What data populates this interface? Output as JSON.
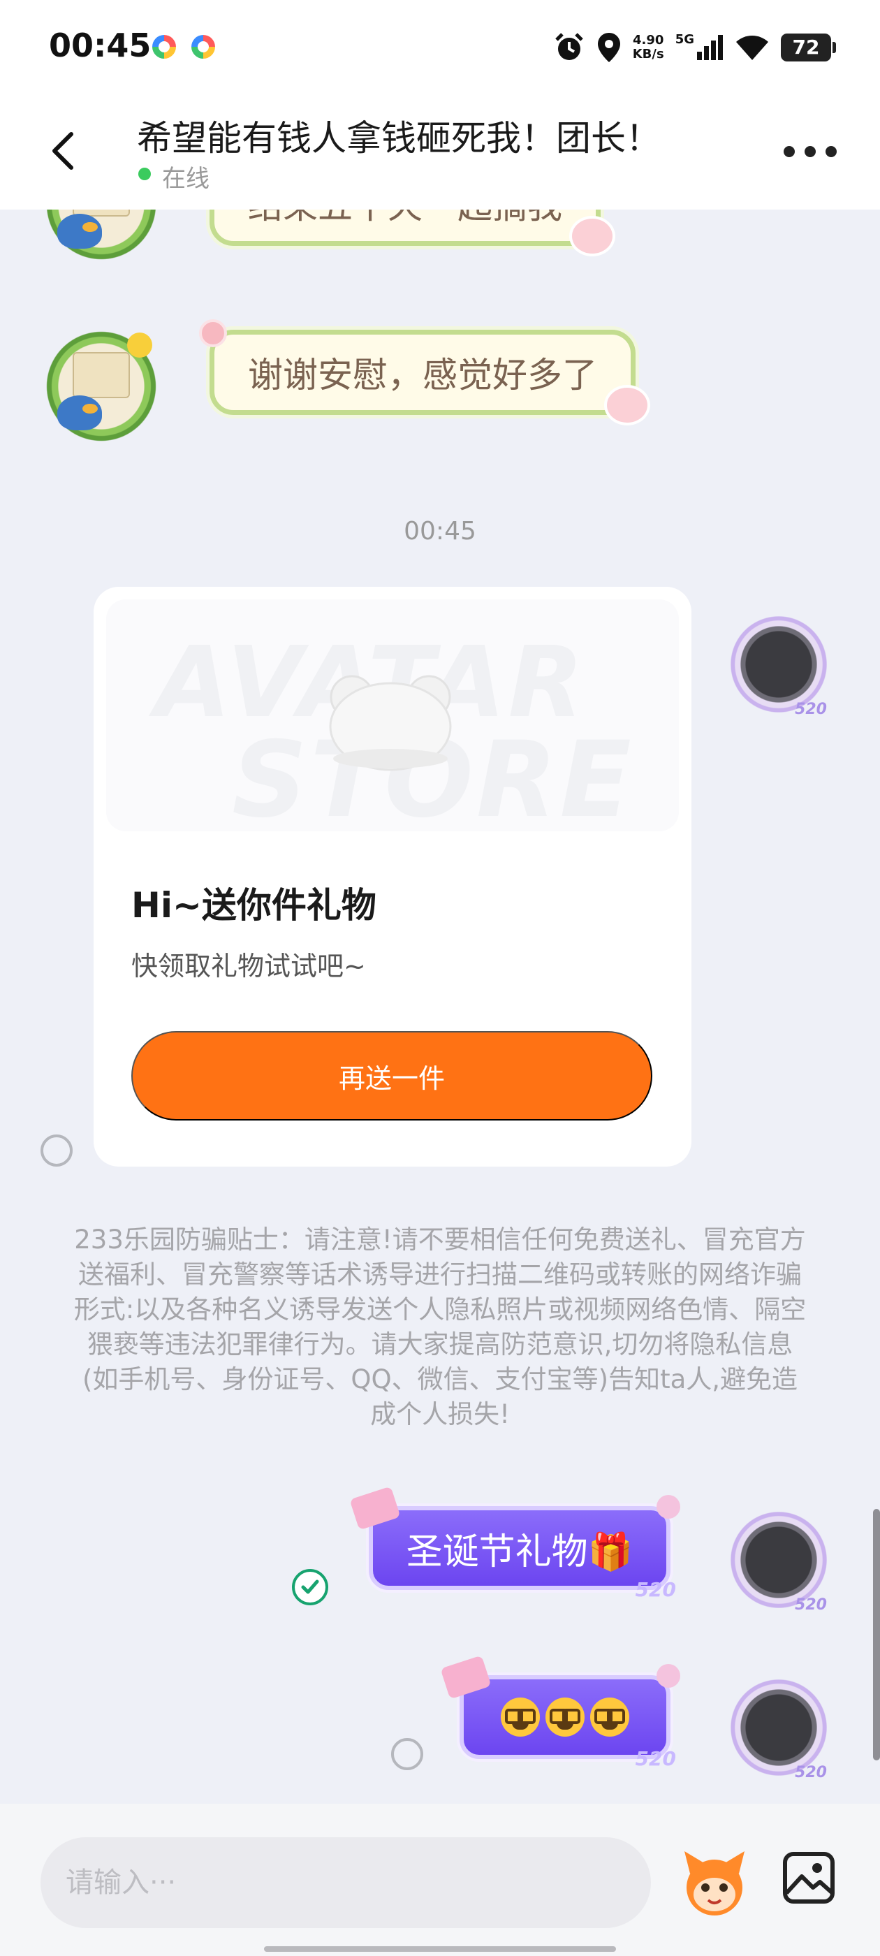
{
  "status_bar": {
    "time": "00:45",
    "net_speed_value": "4.90",
    "net_speed_unit": "KB/s",
    "network_type": "5G",
    "battery": "72"
  },
  "header": {
    "title": "希望能有钱人拿钱砸死我！团长！",
    "status": "在线"
  },
  "messages": {
    "partial_text": "结束五十天一起搞我",
    "received_text": "谢谢安慰，感觉好多了",
    "timestamp": "00:45",
    "gift_card": {
      "watermark_top": "AVATAR",
      "watermark_bottom": "STORE",
      "title": "Hi~送你件礼物",
      "subtitle": "快领取礼物试试吧~",
      "button_label": "再送一件"
    },
    "safety_tip": "233乐园防骗贴士：请注意!请不要相信任何免费送礼、冒充官方送福利、冒充警察等话术诱导进行扫描二维码或转账的网络诈骗形式:以及各种名义诱导发送个人隐私照片或视频网络色情、隔空猥亵等违法犯罪律行为。请大家提高防范意识,切勿将隐私信息(如手机号、身份证号、QQ、微信、支付宝等)告知ta人,避免造成个人损失!",
    "sent_text": "圣诞节礼物🎁",
    "bubble_tag": "520",
    "emoji_icons": [
      "nerd-face-emoji",
      "nerd-face-emoji",
      "nerd-face-emoji"
    ]
  },
  "input": {
    "placeholder": "请输入···"
  },
  "colors": {
    "accent_orange": "#ff7214",
    "online_green": "#3bcb5e",
    "sent_bubble_purple": "#7a55f5",
    "received_bubble_border": "#c3dc8f"
  }
}
